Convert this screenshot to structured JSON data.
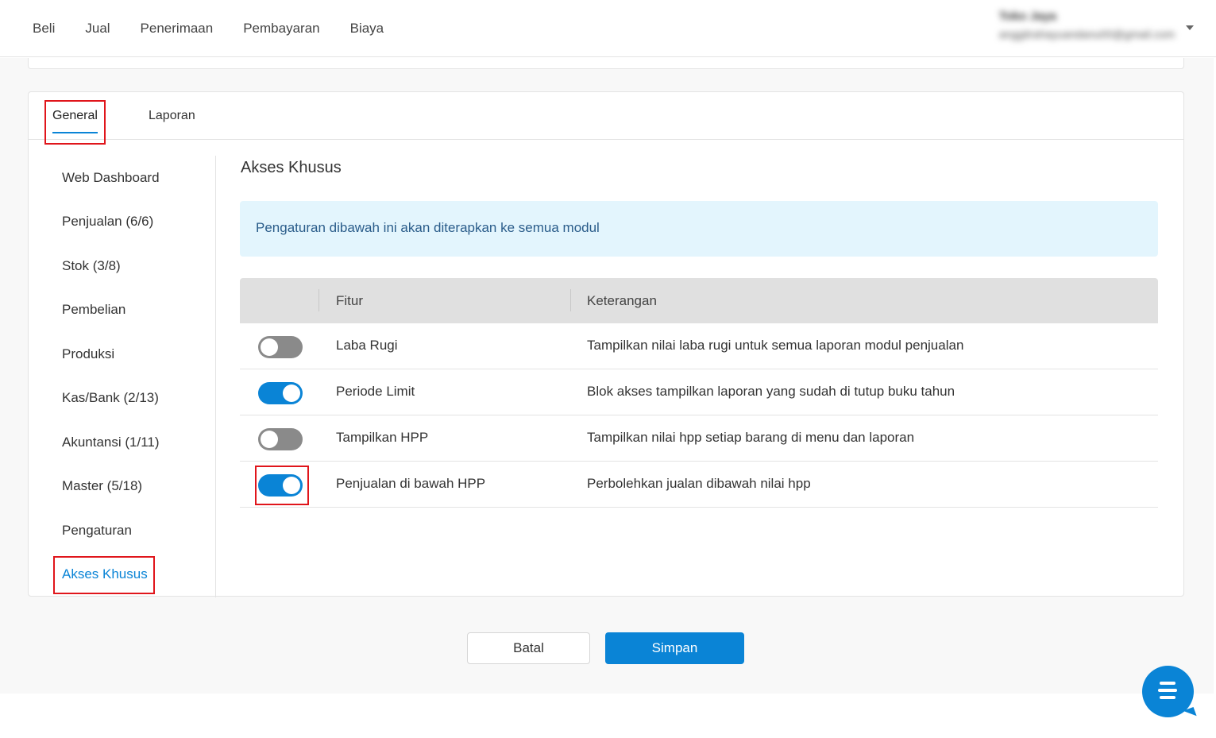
{
  "topnav": {
    "items": [
      "Beli",
      "Jual",
      "Penerimaan",
      "Pembayaran",
      "Biaya"
    ]
  },
  "account": {
    "name": "Toko Jaya",
    "email": "anggitrahayuandanu00@gmail.com"
  },
  "tabs": [
    "General",
    "Laporan"
  ],
  "sidebar": {
    "items": [
      "Web Dashboard",
      "Penjualan (6/6)",
      "Stok (3/8)",
      "Pembelian",
      "Produksi",
      "Kas/Bank (2/13)",
      "Akuntansi (1/11)",
      "Master (5/18)",
      "Pengaturan",
      "Akses Khusus"
    ],
    "active": "Akses Khusus"
  },
  "panel": {
    "title": "Akses Khusus",
    "info": "Pengaturan dibawah ini akan diterapkan ke semua modul",
    "columns": [
      "",
      "Fitur",
      "Keterangan"
    ],
    "rows": [
      {
        "enabled": false,
        "fitur": "Laba Rugi",
        "keterangan": "Tampilkan nilai laba rugi untuk semua laporan modul penjualan"
      },
      {
        "enabled": true,
        "fitur": "Periode Limit",
        "keterangan": "Blok akses tampilkan laporan yang sudah di tutup buku tahun"
      },
      {
        "enabled": false,
        "fitur": "Tampilkan HPP",
        "keterangan": "Tampilkan nilai hpp setiap barang di menu dan laporan"
      },
      {
        "enabled": true,
        "fitur": "Penjualan di bawah HPP",
        "keterangan": "Perbolehkan jualan dibawah nilai hpp"
      }
    ]
  },
  "buttons": {
    "cancel": "Batal",
    "save": "Simpan"
  },
  "colors": {
    "accent": "#0a84d6",
    "highlight": "#e0151b",
    "info_bg": "#e3f5fd"
  }
}
